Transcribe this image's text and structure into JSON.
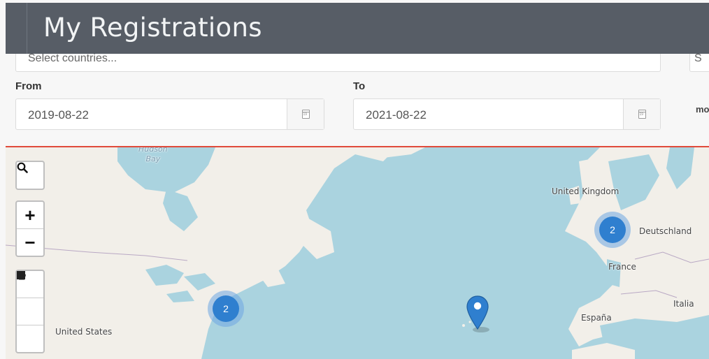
{
  "header": {
    "title": "My Registrations"
  },
  "filters": {
    "countries_placeholder": "Select countries...",
    "second_select_placeholder": "S",
    "from_label": "From",
    "from_value": "2019-08-22",
    "to_label": "To",
    "to_value": "2021-08-22",
    "more_label": "mo"
  },
  "map": {
    "labels": {
      "hudson_bay": "Hudson\nBay",
      "united_kingdom": "United Kingdom",
      "deutschland": "Deutschland",
      "france": "France",
      "italia": "Italia",
      "espana": "España",
      "united_states": "United States"
    },
    "clusters": [
      {
        "count": "2"
      },
      {
        "count": "2"
      }
    ],
    "controls": {
      "zoom_in": "+",
      "zoom_out": "−"
    },
    "colors": {
      "sea": "#aad3df",
      "land": "#f2efe9",
      "accent": "#e04a3a",
      "cluster": "#2f7fcf"
    }
  }
}
